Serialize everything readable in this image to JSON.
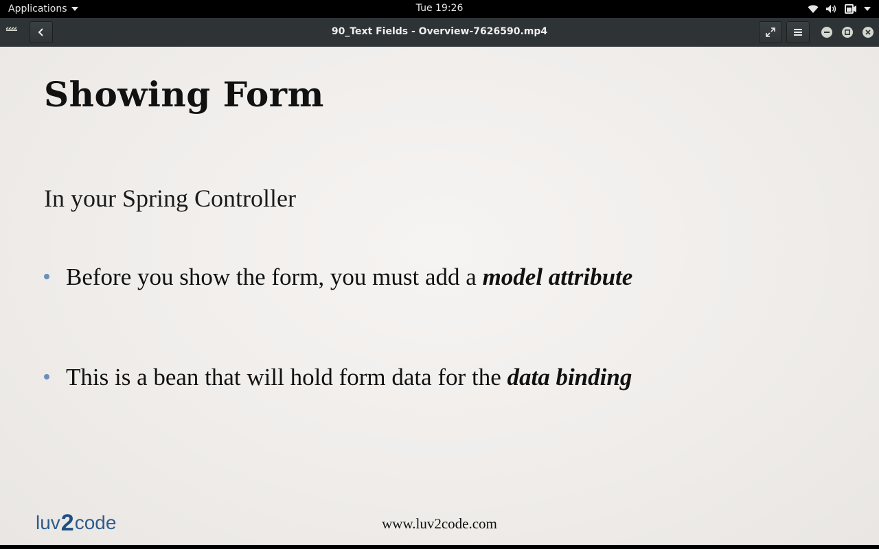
{
  "system_bar": {
    "applications_label": "Applications",
    "clock": "Tue 19:26",
    "icons": [
      "wifi-icon",
      "volume-icon",
      "battery-icon",
      "chevron-down-icon"
    ]
  },
  "window": {
    "title": "90_Text Fields - Overview-7626590.mp4",
    "buttons": [
      "back-button",
      "fullscreen-button",
      "menu-button",
      "minimize-button",
      "maximize-button",
      "close-button"
    ]
  },
  "slide": {
    "title": "Showing Form",
    "subtitle": "In your Spring Controller",
    "bullets": [
      {
        "text": "Before you show the form, you must add a ",
        "emphasis": "model attribute"
      },
      {
        "text": "This is a bean that will hold form data for the ",
        "emphasis": "data binding"
      }
    ],
    "logo": {
      "part1": "luv",
      "part2": "2",
      "part3": "code"
    },
    "footer_url": "www.luv2code.com",
    "bullet_color": "#6a8fb8"
  },
  "colors": {
    "topbar_bg": "#000000",
    "titlebar_bg": "#2e3436",
    "slide_bg": "#f0edeb"
  }
}
